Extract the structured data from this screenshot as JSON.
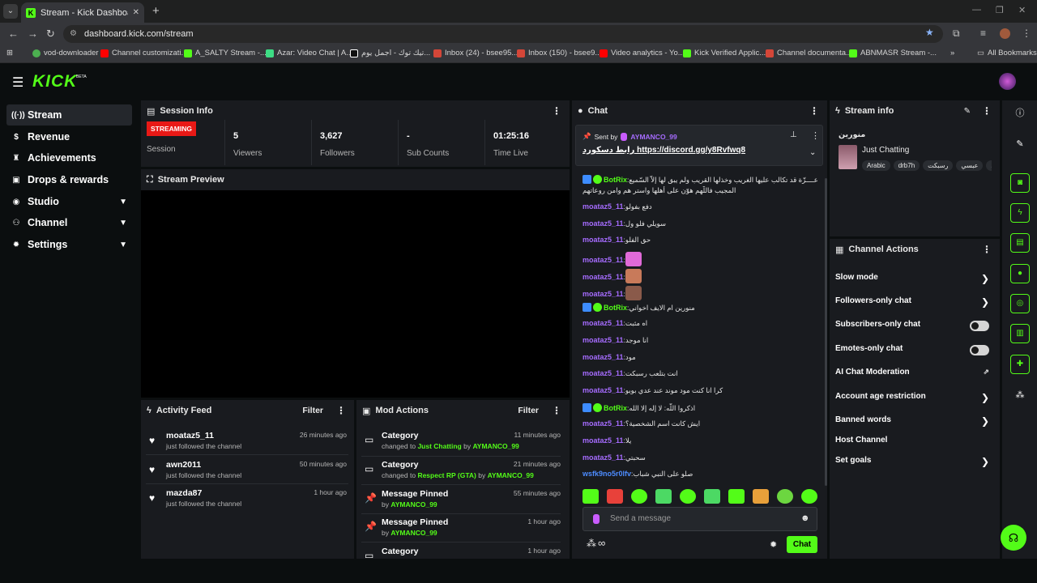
{
  "browser": {
    "tab_title": "Stream - Kick Dashboard",
    "url": "dashboard.kick.com/stream",
    "bookmarks": [
      "vod-downloader",
      "Channel customizati...",
      "A_SALTY Stream -...",
      "Azar: Video Chat | A...",
      "تيك توك - اجمل يوم...",
      "Inbox (24) - bsee95...",
      "Inbox (150) - bsee9...",
      "Video analytics - Yo...",
      "Kick Verified Applic...",
      "Channel documenta...",
      "ABNMASR Stream -..."
    ],
    "all_bookmarks": "All Bookmarks"
  },
  "colors": {
    "accent": "#53fc18",
    "live": "#e91916",
    "panel": "#191b1f",
    "bg": "#0b0e0f",
    "mention": "#a66cff"
  },
  "sidebar": {
    "logo": "KICK",
    "beta": "BETA",
    "items": [
      {
        "label": "Stream",
        "icon": "broadcast-icon",
        "active": true
      },
      {
        "label": "Revenue",
        "icon": "dollar-icon"
      },
      {
        "label": "Achievements",
        "icon": "trophy-icon"
      },
      {
        "label": "Drops & rewards",
        "icon": "gift-icon"
      },
      {
        "label": "Studio",
        "icon": "studio-icon",
        "chevron": true
      },
      {
        "label": "Channel",
        "icon": "users-icon",
        "chevron": true
      },
      {
        "label": "Settings",
        "icon": "gear-icon",
        "chevron": true
      }
    ]
  },
  "session": {
    "title": "Session Info",
    "status": "STREAMING",
    "status_label": "Session",
    "stats": [
      {
        "value": "5",
        "label": "Viewers"
      },
      {
        "value": "3,627",
        "label": "Followers"
      },
      {
        "value": "-",
        "label": "Sub Counts"
      },
      {
        "value": "01:25:16",
        "label": "Time Live"
      }
    ]
  },
  "preview": {
    "title": "Stream Preview"
  },
  "activity": {
    "title": "Activity Feed",
    "filter": "Filter",
    "items": [
      {
        "name": "moataz5_11",
        "sub": "just followed the channel",
        "time": "26 minutes ago"
      },
      {
        "name": "awn2011",
        "sub": "just followed the channel",
        "time": "50 minutes ago"
      },
      {
        "name": "mazda87",
        "sub": "just followed the channel",
        "time": "1 hour ago"
      }
    ]
  },
  "mod": {
    "title": "Mod Actions",
    "filter": "Filter",
    "items": [
      {
        "name": "Category",
        "pre": "changed to ",
        "target": "Just Chatting",
        "mid": " by ",
        "by": "AYMANCO_99",
        "time": "11 minutes ago"
      },
      {
        "name": "Category",
        "pre": "changed to ",
        "target": "Respect RP (GTA)",
        "mid": " by ",
        "by": "AYMANCO_99",
        "time": "21 minutes ago"
      },
      {
        "name": "Message Pinned",
        "pre": "by ",
        "target": "AYMANCO_99",
        "mid": "",
        "by": "",
        "time": "55 minutes ago"
      },
      {
        "name": "Message Pinned",
        "pre": "by ",
        "target": "AYMANCO_99",
        "mid": "",
        "by": "",
        "time": "1 hour ago"
      },
      {
        "name": "Category",
        "pre": "",
        "target": "",
        "mid": "",
        "by": "",
        "time": "1 hour ago"
      }
    ]
  },
  "chat": {
    "title": "Chat",
    "pinned_by_label": "Sent by",
    "pinned_user": "AYMANCO_99",
    "pinned_text": "رابط دسكورد https://discord.gg/y8Rvfwq8",
    "messages": [
      {
        "user": "BotRix",
        "type": "bot",
        "text": "اللّهم عــــزّة قد تكالب عليها الغريب وخذلها القريب ولم يبق لها إلاّ السّميع"
      },
      {
        "user": "",
        "type": "cont",
        "text": "المجيب فاللّهم هوّن على أهلها واستر هم وامن روعاتهم"
      },
      {
        "user": "moataz5_11",
        "type": "user",
        "text": "دفع بفولو"
      },
      {
        "user": "moataz5_11",
        "type": "user",
        "text": "سويلي فلو ول"
      },
      {
        "user": "moataz5_11",
        "type": "user",
        "text": "حق الفلو"
      },
      {
        "user": "moataz5_11",
        "type": "emote",
        "text": ""
      },
      {
        "user": "moataz5_11",
        "type": "emote",
        "text": ""
      },
      {
        "user": "moataz5_11",
        "type": "emote",
        "text": ""
      },
      {
        "user": "BotRix",
        "type": "bot",
        "text": "منورين ام الايف اخواني"
      },
      {
        "user": "moataz5_11",
        "type": "user",
        "text": "اه مثبت"
      },
      {
        "user": "moataz5_11",
        "type": "user",
        "text": "انا موجد"
      },
      {
        "user": "moataz5_11",
        "type": "user",
        "text": "مود"
      },
      {
        "user": "moataz5_11",
        "type": "user",
        "text": "انت بتلعب رسبكت"
      },
      {
        "user": "moataz5_11",
        "type": "user",
        "text": "كرا انا كنت مود موند عند عدي بوبو"
      },
      {
        "user": "BotRix",
        "type": "bot",
        "text": "اذكروا اللّه: لا إله إلا الله"
      },
      {
        "user": "moataz5_11",
        "type": "user",
        "text": "ايش كانت اسم الشخصية؟"
      },
      {
        "user": "moataz5_11",
        "type": "user",
        "text": "يلا"
      },
      {
        "user": "moataz5_11",
        "type": "user",
        "text": "سحبتي"
      },
      {
        "user": "wsfk9no5r0lfv",
        "type": "blue",
        "text": "صلو على النبي شباب"
      }
    ],
    "placeholder": "Send a message",
    "send": "Chat",
    "infinity": "∞"
  },
  "stream_info": {
    "title": "Stream info",
    "stream_title": "منورين",
    "category": "Just Chatting",
    "tags": [
      "Arabic",
      "drb7h",
      "رسبكت",
      "عبسي",
      "عي"
    ]
  },
  "channel_actions": {
    "title": "Channel Actions",
    "items": [
      {
        "label": "Slow mode",
        "ctrl": "arrow"
      },
      {
        "label": "Followers-only chat",
        "ctrl": "arrow"
      },
      {
        "label": "Subscribers-only chat",
        "ctrl": "toggle"
      },
      {
        "label": "Emotes-only chat",
        "ctrl": "toggle"
      },
      {
        "label": "AI Chat Moderation",
        "ctrl": "external"
      },
      {
        "label": "Account age restriction",
        "ctrl": "arrow"
      },
      {
        "label": "Banned words",
        "ctrl": "arrow"
      },
      {
        "label": "Host Channel",
        "ctrl": "none"
      },
      {
        "label": "Set goals",
        "ctrl": "arrow"
      }
    ]
  },
  "rail": [
    "info-icon",
    "pencil-icon",
    "camera-icon",
    "bolt-icon",
    "clipboard-icon",
    "chat-icon",
    "broadcast-icon",
    "layout-icon",
    "wrench-icon",
    "dots-icon",
    "support-icon"
  ]
}
